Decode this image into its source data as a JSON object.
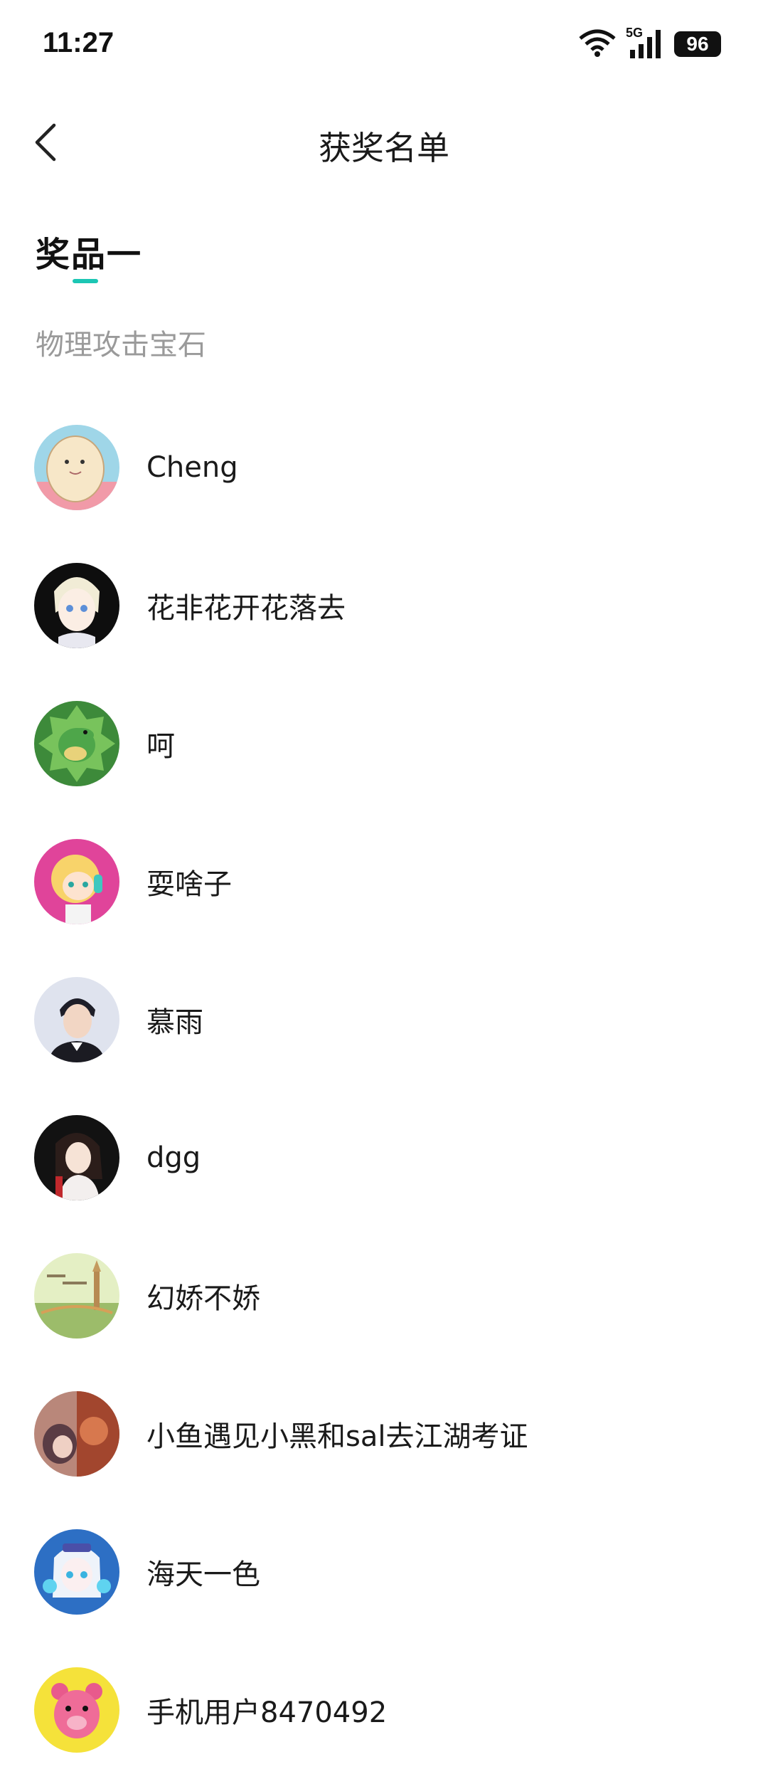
{
  "status_bar": {
    "time": "11:27",
    "battery": "96",
    "network": "5G"
  },
  "header": {
    "title": "获奖名单"
  },
  "tabs": [
    {
      "label": "奖品一",
      "active": true
    }
  ],
  "prize": {
    "name": "物理攻击宝石"
  },
  "winners": [
    {
      "name": "Cheng",
      "avatar_bg": "#f2d9b8",
      "avatar_fg": "#f7e7c8"
    },
    {
      "name": "花非花开花落去",
      "avatar_bg": "#0e0e0e",
      "avatar_fg": "#f4efe2"
    },
    {
      "name": "呵",
      "avatar_bg": "#3d8a3a",
      "avatar_fg": "#76c05a"
    },
    {
      "name": "耍啥子",
      "avatar_bg": "#e0449a",
      "avatar_fg": "#f8d36a"
    },
    {
      "name": "慕雨",
      "avatar_bg": "#dfe3ee",
      "avatar_fg": "#1e1e28"
    },
    {
      "name": "dgg",
      "avatar_bg": "#121212",
      "avatar_fg": "#f3e2d8"
    },
    {
      "name": "幻娇不娇",
      "avatar_bg": "#cfe3b0",
      "avatar_fg": "#c9a36a"
    },
    {
      "name": "小鱼遇见小黑和sal去江湖考证",
      "avatar_bg": "#b8826a",
      "avatar_fg": "#e5c2b2"
    },
    {
      "name": "海天一色",
      "avatar_bg": "#2d6fc4",
      "avatar_fg": "#eef3fa"
    },
    {
      "name": "手机用户8470492",
      "avatar_bg": "#f5e23a",
      "avatar_fg": "#e85a8c"
    }
  ],
  "colors": {
    "accent": "#1cc6b4",
    "subtitle": "#9a9a9a"
  }
}
